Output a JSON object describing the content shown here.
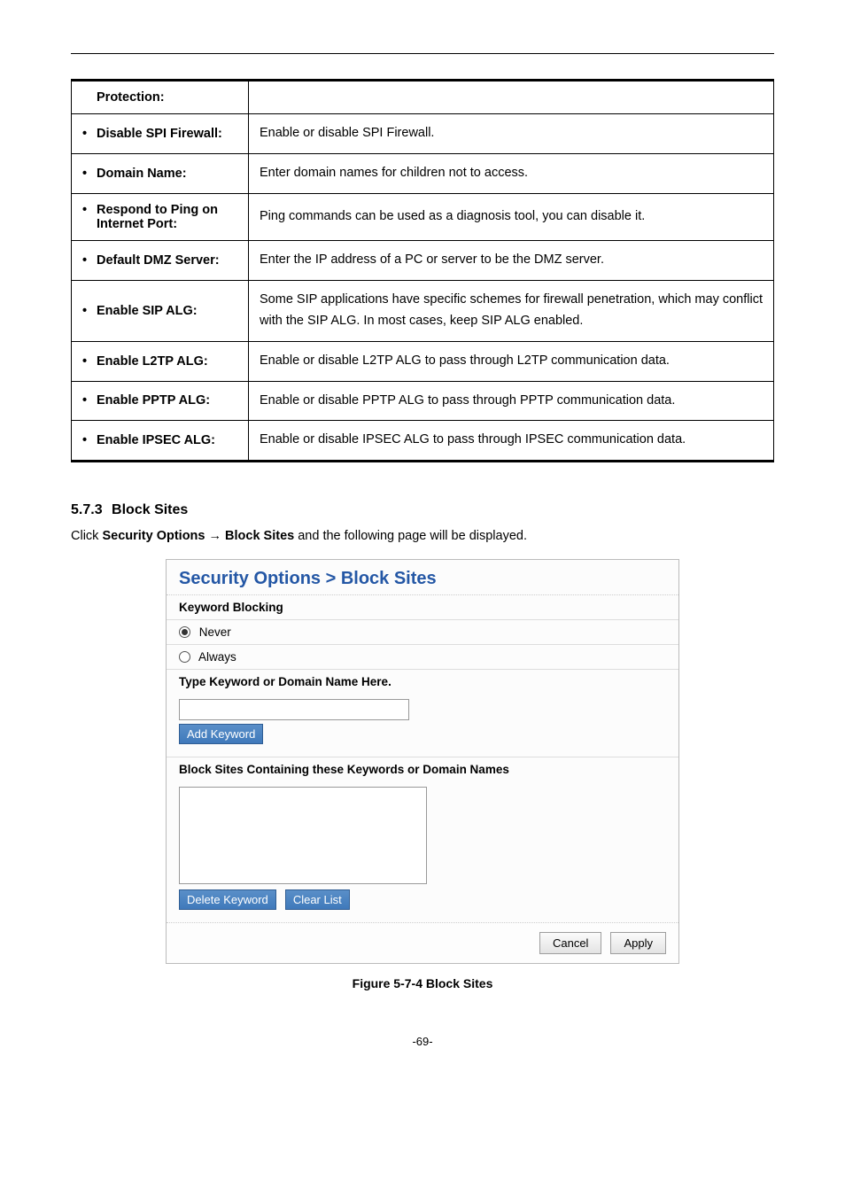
{
  "table": {
    "rows": [
      {
        "label": "Protection:",
        "desc": "",
        "bulleted": false,
        "justify": false
      },
      {
        "label": "Disable SPI Firewall:",
        "desc": "Enable or disable SPI Firewall.",
        "bulleted": true,
        "justify": false
      },
      {
        "label": "Domain Name:",
        "desc": "Enter domain names for children not to access.",
        "bulleted": true,
        "justify": false
      },
      {
        "label": "Respond to Ping on Internet Port:",
        "desc": "Ping commands can be used as a diagnosis tool, you can disable it.",
        "bulleted": true,
        "justify": false
      },
      {
        "label": "Default DMZ Server:",
        "desc": "Enter the IP address of a PC or server to be the DMZ server.",
        "bulleted": true,
        "justify": false
      },
      {
        "label": "Enable SIP ALG:",
        "desc": "Some SIP applications have specific schemes for firewall penetration, which may conflict with the SIP ALG. In most cases, keep SIP ALG enabled.",
        "bulleted": true,
        "justify": true
      },
      {
        "label": "Enable L2TP ALG:",
        "desc": "Enable or disable L2TP ALG to pass through L2TP communication data.",
        "bulleted": true,
        "justify": false
      },
      {
        "label": "Enable PPTP ALG:",
        "desc": "Enable or disable PPTP ALG to pass through PPTP communication data.",
        "bulleted": true,
        "justify": true
      },
      {
        "label": "Enable IPSEC ALG:",
        "desc": "Enable or disable IPSEC ALG to pass through IPSEC communication data.",
        "bulleted": true,
        "justify": true
      }
    ]
  },
  "section": {
    "num": "5.7.3",
    "title": "Block Sites"
  },
  "clickpath": {
    "prefix": "Click ",
    "bold1": "Security Options",
    "arrow": " → ",
    "bold2": "Block Sites",
    "suffix": " and the following page will be displayed."
  },
  "screenshot": {
    "title": "Security Options > Block Sites",
    "keyword_blocking": "Keyword Blocking",
    "never": "Never",
    "always": "Always",
    "type_label": "Type Keyword or Domain Name Here.",
    "add_keyword": "Add Keyword",
    "block_sites_label": "Block Sites Containing these Keywords or Domain Names",
    "delete_keyword": "Delete Keyword",
    "clear_list": "Clear List",
    "cancel": "Cancel",
    "apply": "Apply"
  },
  "caption": "Figure 5-7-4 Block Sites",
  "pagenum": "-69-"
}
